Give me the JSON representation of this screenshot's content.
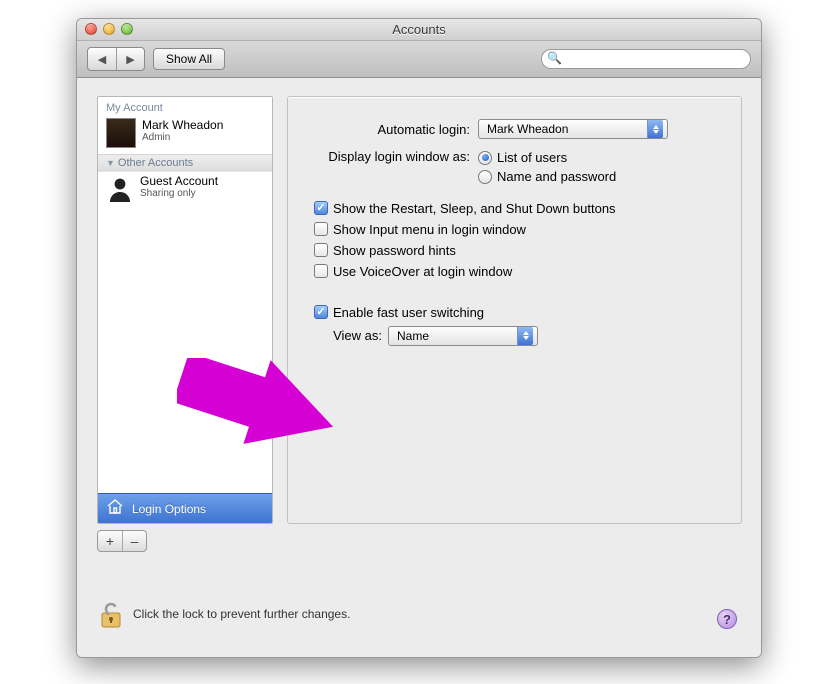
{
  "window": {
    "title": "Accounts"
  },
  "toolbar": {
    "back": "◀",
    "forward": "▶",
    "show_all": "Show All",
    "search_placeholder": ""
  },
  "sidebar": {
    "my_account_header": "My Account",
    "user": {
      "name": "Mark Wheadon",
      "role": "Admin"
    },
    "other_header": "Other Accounts",
    "guest": {
      "name": "Guest Account",
      "role": "Sharing only"
    },
    "login_options": "Login Options"
  },
  "controls": {
    "add": "+",
    "remove": "–"
  },
  "panel": {
    "auto_login_label": "Automatic login:",
    "auto_login_value": "Mark Wheadon",
    "display_as_label": "Display login window as:",
    "radio_list": "List of users",
    "radio_name": "Name and password",
    "cb_restart": "Show the Restart, Sleep, and Shut Down buttons",
    "cb_input": "Show Input menu in login window",
    "cb_hints": "Show password hints",
    "cb_voiceover": "Use VoiceOver at login window",
    "cb_fastswitch": "Enable fast user switching",
    "view_as_label": "View as:",
    "view_as_value": "Name"
  },
  "footer": {
    "lock_text": "Click the lock to prevent further changes."
  }
}
